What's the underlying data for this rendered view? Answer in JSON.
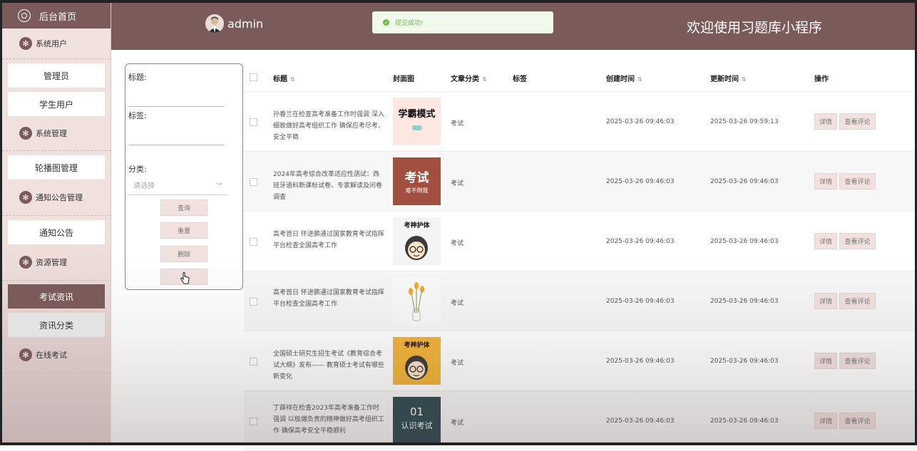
{
  "sidebar": {
    "home_label": "后台首页",
    "groups": [
      {
        "label": "系统用户",
        "items": [
          {
            "label": "管理员"
          },
          {
            "label": "学生用户"
          }
        ]
      },
      {
        "label": "系统管理",
        "items": [
          {
            "label": "轮播图管理"
          }
        ]
      },
      {
        "label": "通知公告管理",
        "items": [
          {
            "label": "通知公告"
          }
        ]
      },
      {
        "label": "资源管理",
        "items": [
          {
            "label": "考试资讯",
            "active": true
          },
          {
            "label": "资讯分类"
          }
        ]
      },
      {
        "label": "在线考试",
        "items": []
      }
    ]
  },
  "header": {
    "username": "admin",
    "welcome": "欢迎使用习题库小程序",
    "toast": "提交成功!"
  },
  "search": {
    "title_label": "标题:",
    "tag_label": "标签:",
    "category_label": "分类:",
    "category_placeholder": "请选择",
    "query_button": "查询",
    "reset_button": "重置",
    "delete_button": "删除",
    "blank_button": ""
  },
  "table": {
    "headers": {
      "title": "标题",
      "cover": "封面图",
      "category": "文章分类",
      "tags": "标签",
      "created": "创建时间",
      "updated": "更新时间",
      "actions": "操作"
    },
    "detail_label": "详情",
    "comment_label": "查看评论",
    "rows": [
      {
        "title": "孙春兰在检查高考准备工作时强调 深入细致做好高考组织工作 确保应考尽考、安全平稳",
        "category": "考试",
        "tags": "",
        "created": "2025-03-26 09:46:03",
        "updated": "2025-03-26 09:59:13",
        "cover_text": "学霸模式",
        "cover_bg": "#fde7e1"
      },
      {
        "title": "2024年高考综合改革适应性测试：西班牙语科新课标试卷、专家解读及问卷调查",
        "category": "考试",
        "tags": "",
        "created": "2025-03-26 09:46:03",
        "updated": "2025-03-26 09:46:03",
        "cover_text": "考试",
        "cover_sub": "难不倒我",
        "cover_bg": "#a24f3f"
      },
      {
        "title": "高考首日 怀进鹏通过国家教育考试指挥平台检查全国高考工作",
        "category": "考试",
        "tags": "",
        "created": "2025-03-26 09:46:03",
        "updated": "2025-03-26 09:46:03",
        "cover_text": "考神护体",
        "cover_bg": "#f4f4f4"
      },
      {
        "title": "高考首日 怀进鹏通过国家教育考试指挥平台检查全国高考工作",
        "category": "考试",
        "tags": "",
        "created": "2025-03-26 09:46:03",
        "updated": "2025-03-26 09:46:03",
        "cover_text": "",
        "cover_bg": "#fafafa"
      },
      {
        "title": "全国硕士研究生招生考试《教育综合考试大纲》发布—— 教育硕士考试有哪些新变化",
        "category": "考试",
        "tags": "",
        "created": "2025-03-26 09:46:03",
        "updated": "2025-03-26 09:46:03",
        "cover_text": "考神护体",
        "cover_bg": "#f2b437"
      },
      {
        "title": "丁薛祥在检查2023年高考准备工作时强调 以极端负责的精神做好高考组织工作 确保高考安全平稳顺利",
        "category": "考试",
        "tags": "",
        "created": "2025-03-26 09:46:03",
        "updated": "2025-03-26 09:46:03",
        "cover_text": "01",
        "cover_sub": "认识考试",
        "cover_bg": "#2f4a52"
      }
    ]
  }
}
